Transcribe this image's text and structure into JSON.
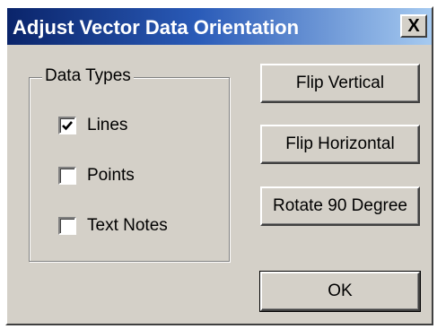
{
  "window": {
    "title": "Adjust Vector Data Orientation",
    "close_label": "X"
  },
  "data_types": {
    "legend": "Data Types",
    "options": [
      {
        "label": "Lines",
        "checked": true
      },
      {
        "label": "Points",
        "checked": false
      },
      {
        "label": "Text Notes",
        "checked": false
      }
    ]
  },
  "buttons": {
    "flip_vertical": "Flip Vertical",
    "flip_horizontal": "Flip Horizontal",
    "rotate_90": "Rotate 90 Degree",
    "ok": "OK"
  },
  "colors": {
    "title_gradient_start": "#0a246a",
    "title_gradient_end": "#a6caf0",
    "face": "#d4d0c8"
  },
  "icons": {
    "close": "close-icon",
    "check": "checkmark-icon"
  }
}
